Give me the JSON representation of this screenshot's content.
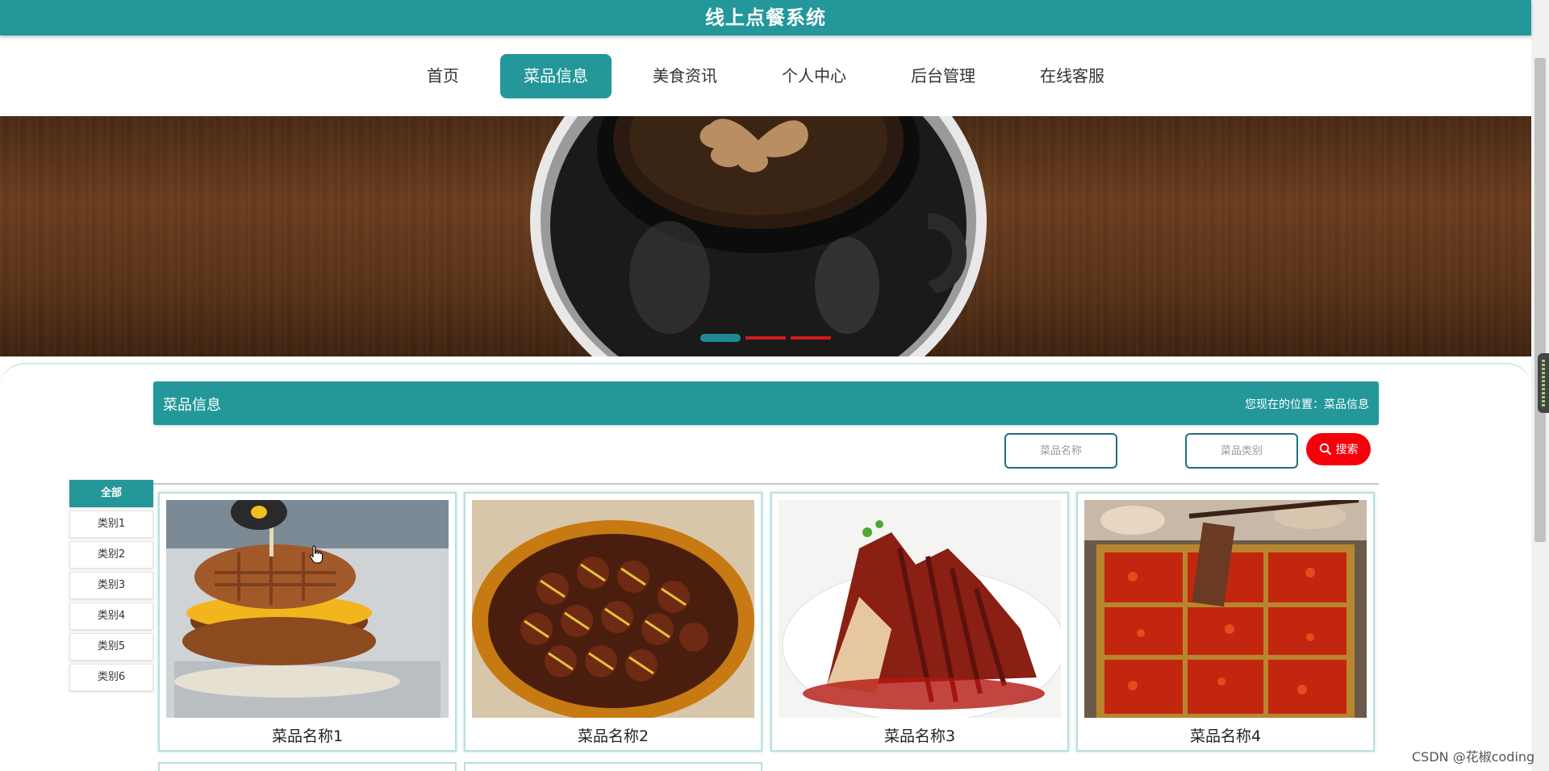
{
  "header": {
    "title": "线上点餐系统"
  },
  "nav": {
    "items": [
      {
        "label": "首页",
        "active": false
      },
      {
        "label": "菜品信息",
        "active": true
      },
      {
        "label": "美食资讯",
        "active": false
      },
      {
        "label": "个人中心",
        "active": false
      },
      {
        "label": "后台管理",
        "active": false
      },
      {
        "label": "在线客服",
        "active": false
      }
    ]
  },
  "banner": {
    "slide_count": 3,
    "active_slide": 1
  },
  "section": {
    "title": "菜品信息",
    "location": "您现在的位置：菜品信息"
  },
  "search": {
    "name_placeholder": "菜品名称",
    "category_placeholder": "菜品类别",
    "button_label": "搜索"
  },
  "categories": [
    "全部",
    "类别1",
    "类别2",
    "类别3",
    "类别4",
    "类别5",
    "类别6"
  ],
  "dishes": [
    {
      "name": "菜品名称1"
    },
    {
      "name": "菜品名称2"
    },
    {
      "name": "菜品名称3"
    },
    {
      "name": "菜品名称4"
    }
  ],
  "watermark": "CSDN @花椒coding",
  "colors": {
    "primary": "#23979a",
    "search_button": "#f5000a",
    "indicator": "#d11a1a"
  }
}
